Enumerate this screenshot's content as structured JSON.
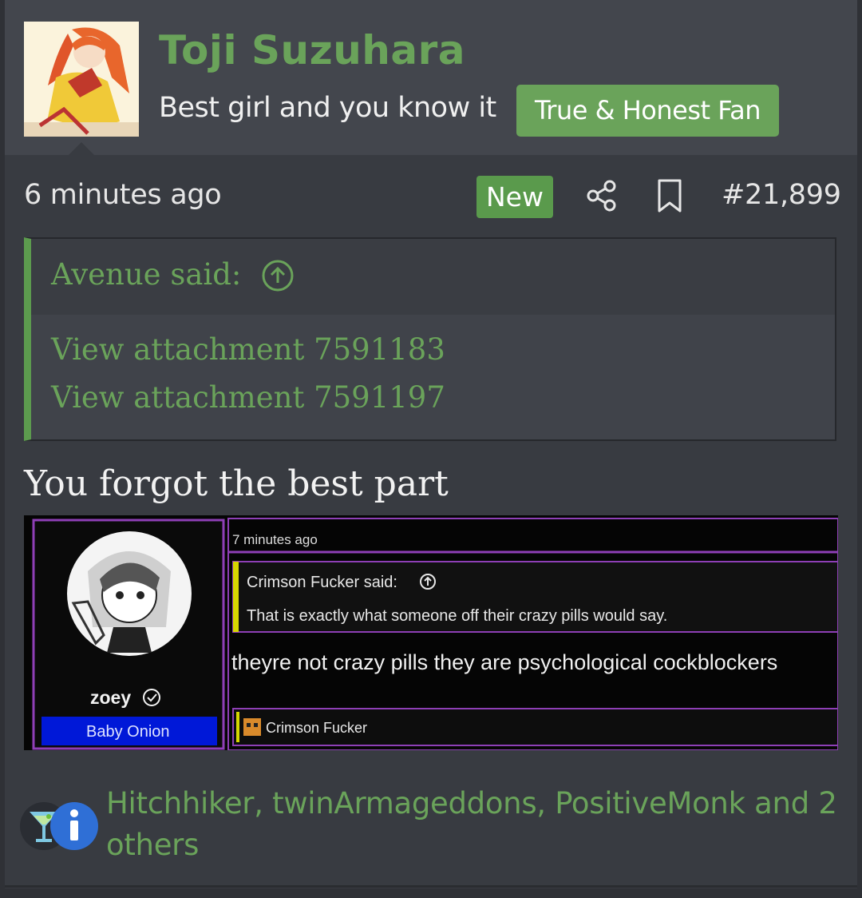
{
  "post": {
    "username": "Toji Suzuhara",
    "user_title": "Best girl and you know it",
    "banner": "True & Honest Fan",
    "timestamp": "6 minutes ago",
    "new_badge": "New",
    "post_number": "#21,899"
  },
  "quote": {
    "author_line": "Avenue said:",
    "attachments": [
      "View attachment 7591183",
      "View attachment 7591197"
    ]
  },
  "reply_text": "You forgot the best part",
  "embedded_screenshot": {
    "timestamp": "7 minutes ago",
    "quote_author": "Crimson Fucker said:",
    "quote_text": "That is exactly what someone off their crazy pills would say.",
    "reply_text": "theyre not crazy pills they are psychological cockblockers",
    "username": "zoey",
    "user_title": "Baby Onion",
    "reaction_user": "Crimson Fucker"
  },
  "reactions": {
    "text": "Hitchhiker, twinArmageddons, PositiveMonk and 2 others",
    "icons": [
      "cocktail-icon",
      "info-icon"
    ]
  },
  "colors": {
    "accent": "#6aa35a",
    "background": "#383b41",
    "header": "#43464d",
    "embed_border": "#8e3fb6",
    "embed_title_bg": "#0018d8"
  }
}
